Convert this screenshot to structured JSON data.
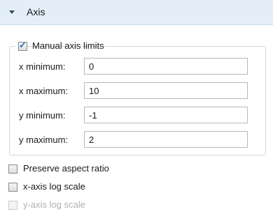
{
  "section": {
    "title": "Axis"
  },
  "manual_limits": {
    "label": "Manual axis limits",
    "checked": true
  },
  "fields": [
    {
      "label": "x minimum:",
      "value": "0"
    },
    {
      "label": "x maximum:",
      "value": "10"
    },
    {
      "label": "y minimum:",
      "value": "-1"
    },
    {
      "label": "y maximum:",
      "value": "2"
    }
  ],
  "options": [
    {
      "label": "Preserve aspect ratio",
      "checked": false,
      "enabled": true
    },
    {
      "label": "x-axis log scale",
      "checked": false,
      "enabled": true
    },
    {
      "label": "y-axis log scale",
      "checked": false,
      "enabled": false
    }
  ],
  "icons": {
    "section_toggle": "caret-down-icon",
    "check": "checkmark-icon"
  }
}
